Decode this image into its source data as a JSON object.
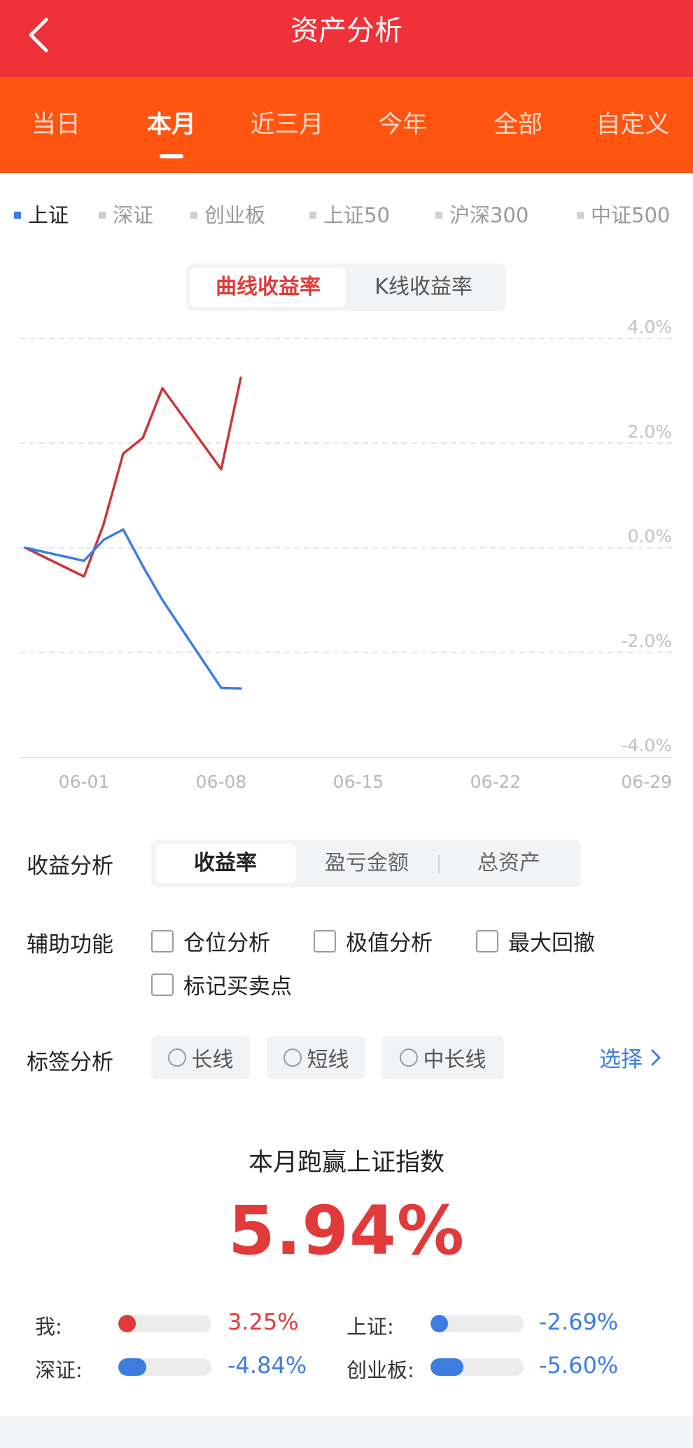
{
  "header": {
    "title": "资产分析",
    "back_icon": "chevron-left-icon"
  },
  "tabs": [
    {
      "label": "当日",
      "active": false
    },
    {
      "label": "本月",
      "active": true
    },
    {
      "label": "近三月",
      "active": false
    },
    {
      "label": "今年",
      "active": false
    },
    {
      "label": "全部",
      "active": false
    },
    {
      "label": "自定义",
      "active": false
    }
  ],
  "legend": [
    {
      "label": "上证",
      "active": true
    },
    {
      "label": "深证",
      "active": false
    },
    {
      "label": "创业板",
      "active": false
    },
    {
      "label": "上证50",
      "active": false
    },
    {
      "label": "沪深300",
      "active": false
    },
    {
      "label": "中证500",
      "active": false
    }
  ],
  "chart_toggle": {
    "curve": "曲线收益率",
    "kline": "K线收益率",
    "active": "curve"
  },
  "chart_data": {
    "type": "line",
    "title": "",
    "xlabel": "",
    "ylabel": "",
    "x_ticks": [
      "06-01",
      "06-08",
      "06-15",
      "06-22",
      "06-29"
    ],
    "y_ticks": [
      "4.0%",
      "2.0%",
      "0.0%",
      "-2.0%",
      "-4.0%"
    ],
    "ylim": [
      -4.0,
      4.0
    ],
    "y_axis_position": "right",
    "grid": "horizontal dashed",
    "series": [
      {
        "name": "",
        "color": "#c8373c",
        "points": [
          [
            "05-29",
            0.0
          ],
          [
            "06-01",
            -0.55
          ],
          [
            "06-02",
            0.45
          ],
          [
            "06-03",
            1.8
          ],
          [
            "06-04",
            2.1
          ],
          [
            "06-05",
            3.05
          ],
          [
            "06-08",
            1.5
          ],
          [
            "06-09",
            3.25
          ]
        ]
      },
      {
        "name": "上证",
        "color": "#3d7de0",
        "points": [
          [
            "05-29",
            0.0
          ],
          [
            "06-01",
            -0.25
          ],
          [
            "06-02",
            0.15
          ],
          [
            "06-03",
            0.35
          ],
          [
            "06-04",
            -0.35
          ],
          [
            "06-05",
            -1.0
          ],
          [
            "06-08",
            -2.68
          ],
          [
            "06-09",
            -2.69
          ]
        ]
      }
    ]
  },
  "analysis": {
    "label": "收益分析",
    "options": [
      "收益率",
      "盈亏金额",
      "总资产"
    ],
    "active": 0
  },
  "aux": {
    "label": "辅助功能",
    "options": [
      "仓位分析",
      "极值分析",
      "最大回撤",
      "标记买卖点"
    ]
  },
  "tags": {
    "label": "标签分析",
    "options": [
      "长线",
      "短线",
      "中长线"
    ],
    "select": "选择"
  },
  "summary": {
    "title": "本月跑赢上证指数",
    "value": "5.94%"
  },
  "compare": [
    {
      "label": "我:",
      "value": "3.25%",
      "color": "#e23a3a",
      "fill": 0.19
    },
    {
      "label": "上证:",
      "value": "-2.69%",
      "color": "#3d7de0",
      "fill": 0.19
    },
    {
      "label": "深证:",
      "value": "-4.84%",
      "color": "#3d7de0",
      "fill": 0.3
    },
    {
      "label": "创业板:",
      "value": "-5.60%",
      "color": "#3d7de0",
      "fill": 0.35
    }
  ]
}
